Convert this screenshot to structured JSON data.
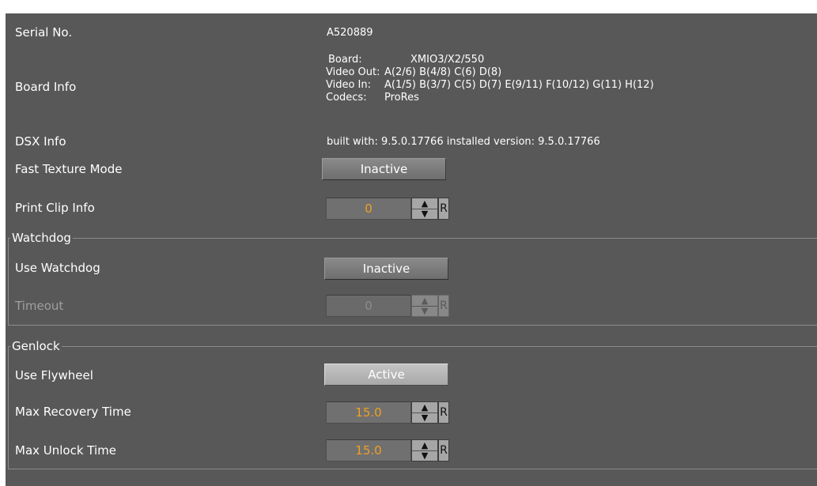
{
  "rows": {
    "serial": {
      "label": "Serial No.",
      "value": "A520889"
    },
    "board_info": {
      "label": "Board Info",
      "lines": [
        {
          "key": "Board:",
          "value": "XMIO3/X2/550"
        },
        {
          "key": "Video Out:",
          "value": "A(2/6) B(4/8) C(6) D(8)"
        },
        {
          "key": "Video In:",
          "value": "A(1/5) B(3/7) C(5) D(7) E(9/11) F(10/12) G(11) H(12)"
        },
        {
          "key": "Codecs:",
          "value": "ProRes"
        }
      ]
    },
    "dsx_info": {
      "label": "DSX Info",
      "value": "built with: 9.5.0.17766 installed version: 9.5.0.17766"
    },
    "fast_texture_mode": {
      "label": "Fast Texture Mode",
      "state": "Inactive"
    },
    "print_clip_info": {
      "label": "Print Clip Info",
      "value": "0",
      "reset": "R"
    }
  },
  "watchdog": {
    "title": "Watchdog",
    "use_watchdog": {
      "label": "Use Watchdog",
      "state": "Inactive"
    },
    "timeout": {
      "label": "Timeout",
      "value": "0",
      "reset": "R"
    }
  },
  "genlock": {
    "title": "Genlock",
    "use_flywheel": {
      "label": "Use Flywheel",
      "state": "Active"
    },
    "max_recovery_time": {
      "label": "Max Recovery Time",
      "value": "15.0",
      "reset": "R"
    },
    "max_unlock_time": {
      "label": "Max Unlock Time",
      "value": "15.0",
      "reset": "R"
    }
  },
  "icons": {
    "spin_up": "triangle-up-icon",
    "spin_down": "triangle-down-icon"
  },
  "colors": {
    "panel_bg": "#585858",
    "value_accent": "#f0a020",
    "dim_text": "#a0a0a0"
  }
}
